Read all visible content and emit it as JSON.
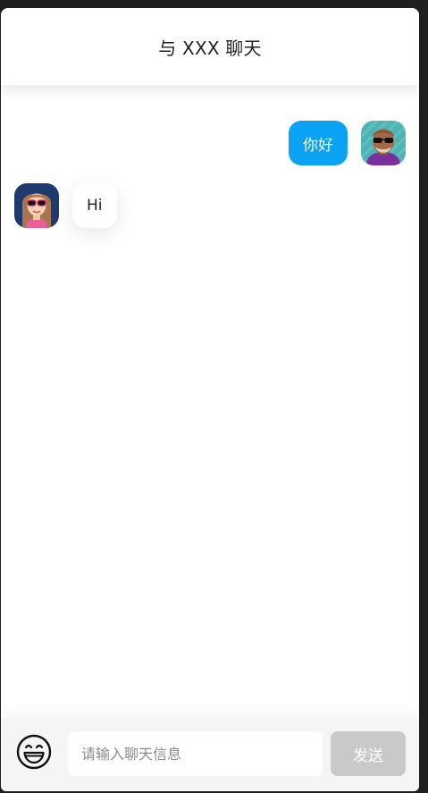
{
  "header": {
    "title": "与 XXX 聊天"
  },
  "messages": [
    {
      "side": "right",
      "text": "你好",
      "avatar": "man-sunglasses-avatar"
    },
    {
      "side": "left",
      "text": "Hi",
      "avatar": "woman-sunglasses-avatar"
    }
  ],
  "composer": {
    "emoji_icon": "grinning-face-icon",
    "placeholder": "请输入聊天信息",
    "value": "",
    "send_label": "发送"
  },
  "colors": {
    "my_bubble": "#0aa2f3",
    "send_disabled": "#c9c9c9",
    "footer_bg": "#f5f5f5"
  }
}
